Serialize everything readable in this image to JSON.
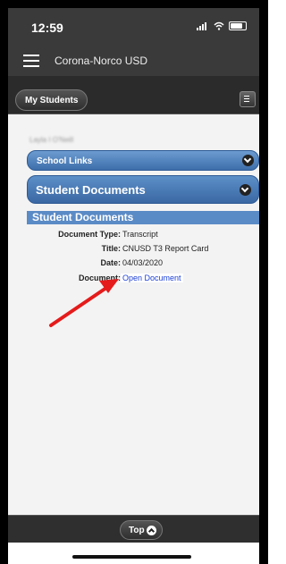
{
  "status": {
    "time": "12:59"
  },
  "app": {
    "title": "Corona-Norco USD"
  },
  "toolbar": {
    "my_students_label": "My Students"
  },
  "student": {
    "name": "Layla I O'Neill"
  },
  "sections": {
    "school_links_label": "School Links",
    "student_documents_label": "Student Documents"
  },
  "documents": {
    "header": "Student Documents",
    "fields": [
      {
        "label": "Document Type:",
        "value": "Transcript"
      },
      {
        "label": "Title:",
        "value": "CNUSD T3 Report Card"
      },
      {
        "label": "Date:",
        "value": "04/03/2020"
      },
      {
        "label": "Document:",
        "value": "Open Document"
      }
    ]
  },
  "footer": {
    "top_label": "Top"
  },
  "colors": {
    "accent": "#5b8bc6",
    "arrow": "#e51b1b",
    "link": "#1b3fd6"
  },
  "icons": [
    "menu-icon",
    "list-icon",
    "chevron-down-icon",
    "chevron-up-icon",
    "signal-icon",
    "wifi-icon",
    "battery-icon"
  ]
}
